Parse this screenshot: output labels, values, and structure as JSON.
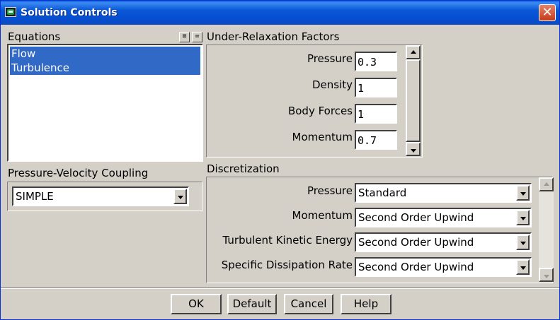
{
  "window": {
    "title": "Solution Controls",
    "close_glyph": "✕"
  },
  "equations": {
    "label": "Equations",
    "items": [
      "Flow",
      "Turbulence"
    ],
    "select_all_glyph": "≡",
    "deselect_all_glyph": "="
  },
  "coupling": {
    "label": "Pressure-Velocity Coupling",
    "selected": "SIMPLE"
  },
  "urf": {
    "label": "Under-Relaxation Factors",
    "rows": [
      {
        "label": "Pressure",
        "value": "0.3"
      },
      {
        "label": "Density",
        "value": "1"
      },
      {
        "label": "Body Forces",
        "value": "1"
      },
      {
        "label": "Momentum",
        "value": "0.7"
      }
    ]
  },
  "discretization": {
    "label": "Discretization",
    "rows": [
      {
        "label": "Pressure",
        "value": "Standard"
      },
      {
        "label": "Momentum",
        "value": "Second Order Upwind"
      },
      {
        "label": "Turbulent Kinetic Energy",
        "value": "Second Order Upwind"
      },
      {
        "label": "Specific Dissipation Rate",
        "value": "Second Order Upwind"
      }
    ]
  },
  "buttons": {
    "ok": "OK",
    "default": "Default",
    "cancel": "Cancel",
    "help": "Help"
  },
  "icons": {
    "app": "fluent-app-icon",
    "close": "close-icon"
  },
  "colors": {
    "titlebar": "#0a57d6",
    "selection": "#3169c6",
    "close": "#c23b19",
    "dialog_bg": "#d4d0c8"
  }
}
